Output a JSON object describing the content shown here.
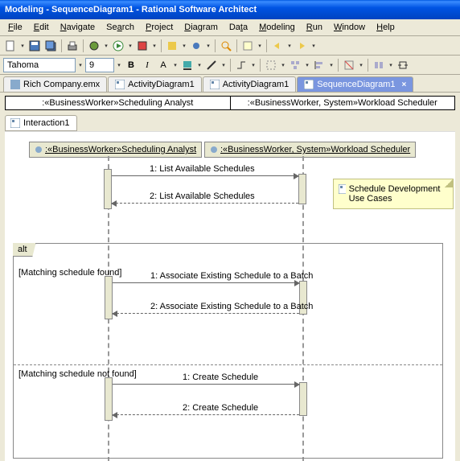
{
  "window": {
    "title": "Modeling - SequenceDiagram1 - Rational Software Architect"
  },
  "menu": [
    "File",
    "Edit",
    "Navigate",
    "Search",
    "Project",
    "Diagram",
    "Data",
    "Modeling",
    "Run",
    "Window",
    "Help"
  ],
  "toolbar2": {
    "font": "Tahoma",
    "size": "9",
    "bold": "B",
    "italic": "I",
    "color": "A"
  },
  "tabs": [
    {
      "label": "Rich Company.emx",
      "active": false
    },
    {
      "label": "ActivityDiagram1",
      "active": false
    },
    {
      "label": "ActivityDiagram1",
      "active": false
    },
    {
      "label": "SequenceDiagram1",
      "active": true
    }
  ],
  "headers": {
    "left": ":«BusinessWorker»Scheduling Analyst",
    "right": ":«BusinessWorker, System»Workload Scheduler"
  },
  "interaction": {
    "label": "Interaction1"
  },
  "lifelines": {
    "l1": ":«BusinessWorker»Scheduling Analyst",
    "l2": ":«BusinessWorker, System»Workload Scheduler"
  },
  "messages": {
    "m1": "1: List Available Schedules",
    "m2": "2: List Available Schedules",
    "m3": "1: Associate Existing Schedule to a Batch",
    "m4": "2: Associate Existing Schedule to a Batch",
    "m5": "1: Create Schedule",
    "m6": "2: Create Schedule"
  },
  "alt": {
    "label": "alt",
    "guard1": "[Matching schedule found]",
    "guard2": "[Matching schedule not found]"
  },
  "note": {
    "text": "Schedule Development Use Cases"
  }
}
